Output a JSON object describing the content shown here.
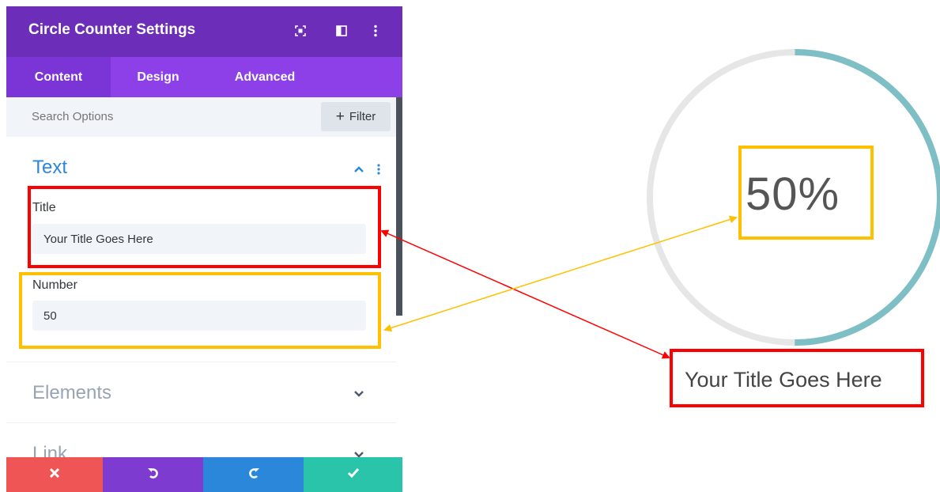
{
  "panel": {
    "header": {
      "title": "Circle Counter Settings",
      "icons": [
        "expand-icon",
        "split-view-icon",
        "more-options-icon"
      ]
    },
    "tabs": [
      {
        "label": "Content",
        "active": true
      },
      {
        "label": "Design",
        "active": false
      },
      {
        "label": "Advanced",
        "active": false
      }
    ],
    "search": {
      "placeholder": "Search Options",
      "filter_label": "Filter"
    },
    "text_section": {
      "title": "Text",
      "title_field": {
        "label": "Title",
        "value": "Your Title Goes Here"
      },
      "number_field": {
        "label": "Number",
        "value": "50"
      }
    },
    "collapsed_sections": [
      "Elements",
      "Link"
    ],
    "footer": [
      "close-icon",
      "undo-icon",
      "redo-icon",
      "check-icon"
    ]
  },
  "preview": {
    "percent": 50,
    "percent_text": "50%",
    "title": "Your Title Goes Here"
  },
  "colors": {
    "header_bg": "#6c2eb9",
    "tabs_bg": "#8e40e8",
    "accent_blue": "#2b87da",
    "ring_track": "#e6e6e6",
    "ring_fill": "#7ebec5",
    "annotation_red": "#ff0000",
    "annotation_yellow": "#ffc000",
    "footer_close": "#ef5555",
    "footer_undo": "#7e3bd0",
    "footer_redo": "#2b87da",
    "footer_save": "#29c4a9"
  }
}
